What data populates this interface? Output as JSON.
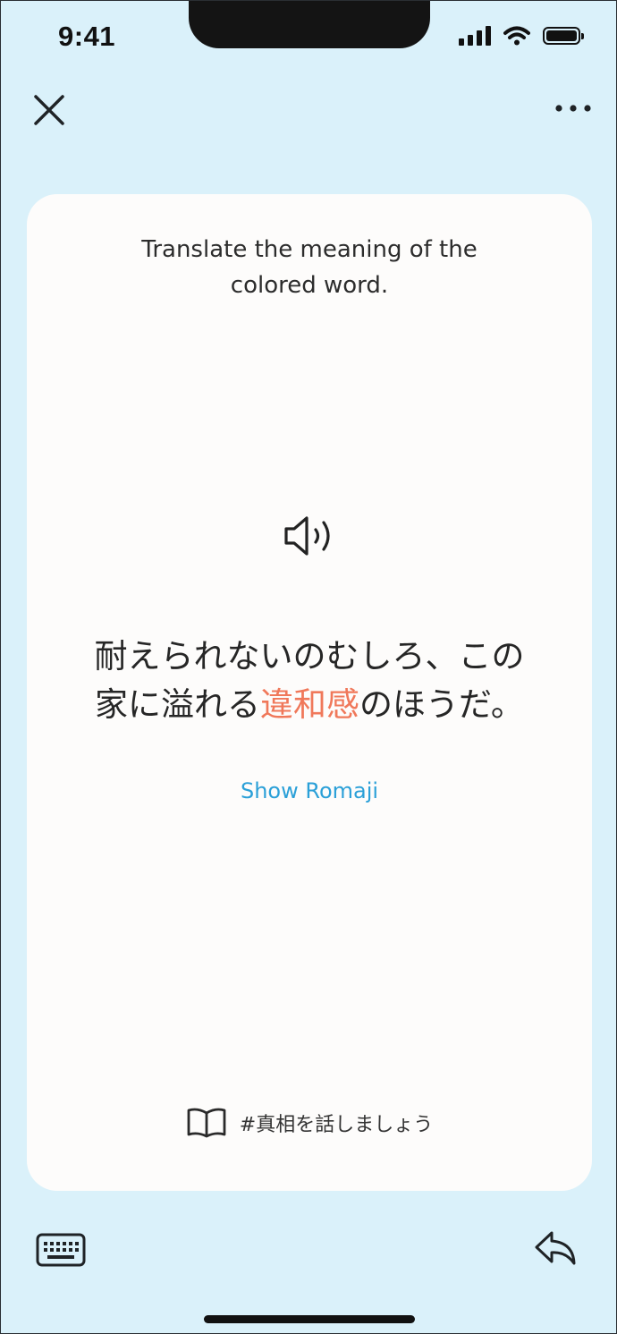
{
  "status_bar": {
    "time": "9:41"
  },
  "toolbar": {
    "close_icon": "close-icon",
    "more_icon": "more-horizontal-icon"
  },
  "card": {
    "instruction": "Translate the meaning of the colored word.",
    "audio_icon": "speaker-icon",
    "sentence_line1": "耐えられないのむしろ、この",
    "sentence_line2_before": "家に溢れる",
    "sentence_highlight": "違和感",
    "sentence_line2_after": "のほうだ。",
    "highlight_color": "#f0785a",
    "show_romaji_label": "Show Romaji",
    "source_icon": "book-icon",
    "source_label": "#真相を話しましょう"
  },
  "bottom_bar": {
    "keyboard_icon": "keyboard-icon",
    "reply_icon": "reply-icon"
  },
  "colors": {
    "background": "#daf1fa",
    "card": "#fdfcfb",
    "link": "#2ba0d8"
  }
}
